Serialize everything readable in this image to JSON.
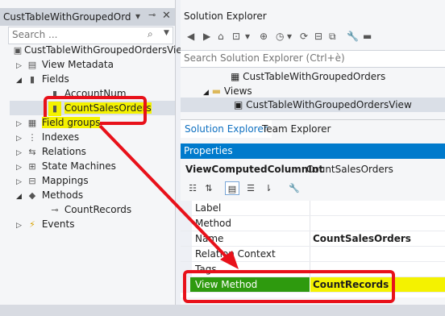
{
  "left_panel": {
    "tab_title": "CustTableWithGroupedOrdersView",
    "search_placeholder": "Search ...",
    "tree": [
      {
        "label": "CustTableWithGroupedOrdersView",
        "icon": "view-icon",
        "twisty": ""
      },
      {
        "label": "View Metadata",
        "icon": "metadata-icon",
        "twisty": "▷"
      },
      {
        "label": "Fields",
        "icon": "fields-icon",
        "twisty": "◢"
      },
      {
        "label": "AccountNum",
        "icon": "field-icon",
        "twisty": ""
      },
      {
        "label": "CountSalesOrders",
        "icon": "computed-field-icon",
        "twisty": ""
      },
      {
        "label": "Field groups",
        "icon": "field-groups-icon",
        "twisty": "▷"
      },
      {
        "label": "Indexes",
        "icon": "indexes-icon",
        "twisty": "▷"
      },
      {
        "label": "Relations",
        "icon": "relations-icon",
        "twisty": "▷"
      },
      {
        "label": "State Machines",
        "icon": "state-machines-icon",
        "twisty": "▷"
      },
      {
        "label": "Mappings",
        "icon": "mappings-icon",
        "twisty": "▷"
      },
      {
        "label": "Methods",
        "icon": "methods-icon",
        "twisty": "◢"
      },
      {
        "label": "CountRecords",
        "icon": "method-icon",
        "twisty": ""
      },
      {
        "label": "Events",
        "icon": "events-icon",
        "twisty": "▷"
      }
    ]
  },
  "solution_explorer": {
    "title": "Solution Explorer",
    "search_placeholder": "Search Solution Explorer (Ctrl+è)",
    "tree": [
      {
        "label": "CustTableWithGroupedOrders",
        "icon": "table-icon",
        "twisty": ""
      },
      {
        "label": "Views",
        "icon": "folder-icon",
        "twisty": "◢"
      },
      {
        "label": "CustTableWithGroupedOrdersView",
        "icon": "view-icon",
        "twisty": ""
      }
    ],
    "tabs": [
      "Solution Explorer",
      "Team Explorer"
    ]
  },
  "properties": {
    "title": "Properties",
    "object_type": "ViewComputedColumnInt",
    "object_name": "CountSalesOrders",
    "rows": [
      {
        "name": "Label",
        "value": ""
      },
      {
        "name": "Method",
        "value": ""
      },
      {
        "name": "Name",
        "value": "CountSalesOrders"
      },
      {
        "name": "Relation Context",
        "value": ""
      },
      {
        "name": "Tags",
        "value": ""
      },
      {
        "name": "View Method",
        "value": "CountRecords"
      }
    ]
  },
  "colors": {
    "callout": "#e8111a",
    "highlight": "#f4f200",
    "selected_property": "#2e9a0e",
    "properties_header": "#007acc"
  }
}
